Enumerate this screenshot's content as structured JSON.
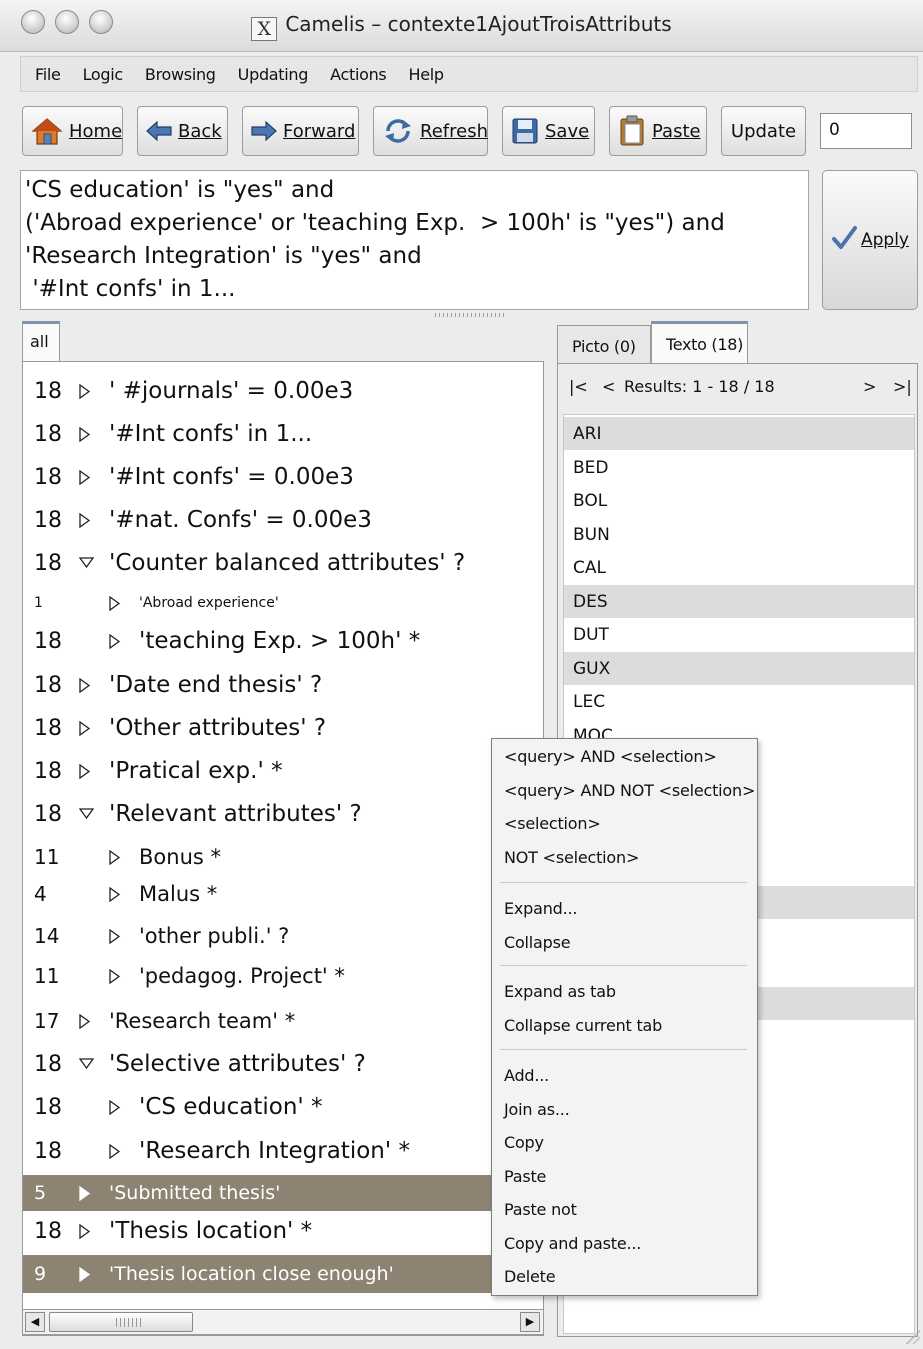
{
  "window": {
    "title": "Camelis – contexte1AjoutTroisAttributs",
    "controls": [
      "close",
      "minimize",
      "zoom"
    ],
    "x_icon_glyph": "X"
  },
  "menubar": [
    "File",
    "Logic",
    "Browsing",
    "Updating",
    "Actions",
    "Help"
  ],
  "toolbar": {
    "home": "Home",
    "back": "Back",
    "forward": "Forward",
    "refresh": "Refresh",
    "save": "Save",
    "paste": "Paste",
    "update": "Update",
    "counter_value": "0"
  },
  "query": {
    "text": "'CS education' is \"yes\" and\n('Abroad experience' or 'teaching Exp.  > 100h' is \"yes\") and\n'Research Integration' is \"yes\" and\n '#Int confs' in 1..."
  },
  "apply_label": "Apply",
  "left_tabs": [
    "all"
  ],
  "tree": [
    {
      "count": "18",
      "label": "' #journals' = 0.00e3",
      "indent": 0,
      "expanded": false,
      "big": true,
      "selected": false
    },
    {
      "count": "18",
      "label": "'#Int confs' in 1...",
      "indent": 0,
      "expanded": false,
      "big": true,
      "selected": false
    },
    {
      "count": "18",
      "label": "'#Int confs' = 0.00e3",
      "indent": 0,
      "expanded": false,
      "big": true,
      "selected": false
    },
    {
      "count": "18",
      "label": "'#nat. Confs' = 0.00e3",
      "indent": 0,
      "expanded": false,
      "big": true,
      "selected": false
    },
    {
      "count": "18",
      "label": "'Counter balanced attributes' ?",
      "indent": 0,
      "expanded": true,
      "big": true,
      "selected": false
    },
    {
      "count": "1",
      "label": "'Abroad experience'",
      "indent": 1,
      "expanded": false,
      "big": false,
      "small": true,
      "selected": false
    },
    {
      "count": "18",
      "label": "'teaching Exp.  > 100h' *",
      "indent": 1,
      "expanded": false,
      "big": true,
      "selected": false
    },
    {
      "count": "18",
      "label": "'Date end thesis' ?",
      "indent": 0,
      "expanded": false,
      "big": true,
      "selected": false
    },
    {
      "count": "18",
      "label": "'Other attributes' ?",
      "indent": 0,
      "expanded": false,
      "big": true,
      "selected": false
    },
    {
      "count": "18",
      "label": "'Pratical exp.' *",
      "indent": 0,
      "expanded": false,
      "big": true,
      "selected": false
    },
    {
      "count": "18",
      "label": "'Relevant attributes' ?",
      "indent": 0,
      "expanded": true,
      "big": true,
      "selected": false
    },
    {
      "count": "11",
      "label": "Bonus *",
      "indent": 1,
      "expanded": false,
      "big": false,
      "selected": false
    },
    {
      "count": "4",
      "label": "Malus *",
      "indent": 1,
      "expanded": false,
      "big": false,
      "selected": false
    },
    {
      "count": "14",
      "label": "'other publi.' ?",
      "indent": 1,
      "expanded": false,
      "big": false,
      "selected": false
    },
    {
      "count": "11",
      "label": "'pedagog. Project' *",
      "indent": 1,
      "expanded": false,
      "big": false,
      "selected": false
    },
    {
      "count": "17",
      "label": "'Research team' *",
      "indent": 0,
      "expanded": false,
      "big": false,
      "selected": false
    },
    {
      "count": "18",
      "label": "'Selective attributes' ?",
      "indent": 0,
      "expanded": true,
      "big": true,
      "selected": false
    },
    {
      "count": "18",
      "label": "'CS education' *",
      "indent": 1,
      "expanded": false,
      "big": true,
      "selected": false
    },
    {
      "count": "18",
      "label": "'Research Integration' *",
      "indent": 1,
      "expanded": false,
      "big": true,
      "selected": false
    },
    {
      "count": "5",
      "label": "'Submitted thesis'",
      "indent": 0,
      "expanded": false,
      "big": false,
      "selected": true
    },
    {
      "count": "18",
      "label": "'Thesis location' *",
      "indent": 0,
      "expanded": false,
      "big": true,
      "selected": false
    },
    {
      "count": "9",
      "label": "'Thesis location close enough'",
      "indent": 0,
      "expanded": false,
      "big": false,
      "selected": true
    }
  ],
  "right_tabs": [
    {
      "label": "Picto (0)",
      "active": false
    },
    {
      "label": "Texto (18)",
      "active": true
    }
  ],
  "results": {
    "first": "|<",
    "prev": "<",
    "label": "Results: 1 - 18 / 18",
    "next": ">",
    "last": ">|",
    "items": [
      {
        "name": "ARI",
        "hl": true
      },
      {
        "name": "BED",
        "hl": false
      },
      {
        "name": "BOL",
        "hl": false
      },
      {
        "name": "BUN",
        "hl": false
      },
      {
        "name": "CAL",
        "hl": false
      },
      {
        "name": "DES",
        "hl": true
      },
      {
        "name": "DUT",
        "hl": false
      },
      {
        "name": "GUX",
        "hl": true
      },
      {
        "name": "LEC",
        "hl": false
      },
      {
        "name": "MOC",
        "hl": false
      },
      {
        "name": "",
        "hl": false
      },
      {
        "name": "",
        "hl": false
      },
      {
        "name": "",
        "hl": false
      },
      {
        "name": "",
        "hl": false
      },
      {
        "name": "",
        "hl": true
      },
      {
        "name": "",
        "hl": false
      },
      {
        "name": "",
        "hl": false
      },
      {
        "name": "",
        "hl": true
      }
    ]
  },
  "context_menu": {
    "groups": [
      [
        "<query> AND <selection>",
        "<query> AND NOT <selection>",
        "<selection>",
        "NOT <selection>"
      ],
      [
        "Expand...",
        "Collapse"
      ],
      [
        "Expand as tab",
        "Collapse current tab"
      ],
      [
        "Add...",
        "Join as...",
        "Copy",
        "Paste",
        "Paste not",
        "Copy and paste...",
        "Delete"
      ]
    ]
  },
  "colors": {
    "selection": "#8d8372",
    "result_highlight": "#dcdcdc",
    "tab_accent": "#7f93ad"
  }
}
